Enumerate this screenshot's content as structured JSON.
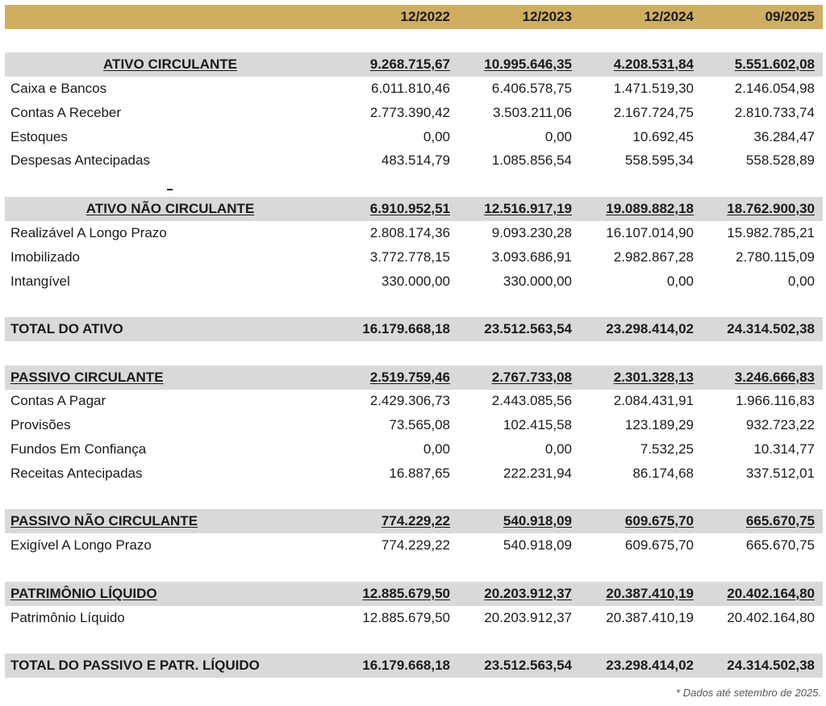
{
  "header": {
    "color": "#cfae62",
    "columns": [
      "12/2022",
      "12/2023",
      "12/2024",
      "09/2025"
    ]
  },
  "ativo_circulante": {
    "label": "ATIVO CIRCULANTE",
    "values": [
      "9.268.715,67",
      "10.995.646,35",
      "4.208.531,84",
      "5.551.602,08"
    ],
    "rows": [
      {
        "label": "Caixa e Bancos",
        "values": [
          "6.011.810,46",
          "6.406.578,75",
          "1.471.519,30",
          "2.146.054,98"
        ]
      },
      {
        "label": "Contas A Receber",
        "values": [
          "2.773.390,42",
          "3.503.211,06",
          "2.167.724,75",
          "2.810.733,74"
        ]
      },
      {
        "label": "Estoques",
        "values": [
          "0,00",
          "0,00",
          "10.692,45",
          "36.284,47"
        ]
      },
      {
        "label": "Despesas Antecipadas",
        "values": [
          "483.514,79",
          "1.085.856,54",
          "558.595,34",
          "558.528,89"
        ]
      }
    ]
  },
  "ativo_nao_circulante": {
    "label": "ATIVO NÃO CIRCULANTE",
    "values": [
      "6.910.952,51",
      "12.516.917,19",
      "19.089.882,18",
      "18.762.900,30"
    ],
    "rows": [
      {
        "label": "Realizável A Longo Prazo",
        "values": [
          "2.808.174,36",
          "9.093.230,28",
          "16.107.014,90",
          "15.982.785,21"
        ]
      },
      {
        "label": "Imobilizado",
        "values": [
          "3.772.778,15",
          "3.093.686,91",
          "2.982.867,28",
          "2.780.115,09"
        ]
      },
      {
        "label": "Intangível",
        "values": [
          "330.000,00",
          "330.000,00",
          "0,00",
          "0,00"
        ]
      }
    ]
  },
  "total_ativo": {
    "label": "TOTAL DO ATIVO",
    "values": [
      "16.179.668,18",
      "23.512.563,54",
      "23.298.414,02",
      "24.314.502,38"
    ]
  },
  "passivo_circulante": {
    "label": "PASSIVO CIRCULANTE",
    "values": [
      "2.519.759,46",
      "2.767.733,08",
      "2.301.328,13",
      "3.246.666,83"
    ],
    "rows": [
      {
        "label": "Contas A Pagar",
        "values": [
          "2.429.306,73",
          "2.443.085,56",
          "2.084.431,91",
          "1.966.116,83"
        ]
      },
      {
        "label": "Provisões",
        "values": [
          "73.565,08",
          "102.415,58",
          "123.189,29",
          "932.723,22"
        ]
      },
      {
        "label": "Fundos Em Confiança",
        "values": [
          "0,00",
          "0,00",
          "7.532,25",
          "10.314,77"
        ]
      },
      {
        "label": "Receitas Antecipadas",
        "values": [
          "16.887,65",
          "222.231,94",
          "86.174,68",
          "337.512,01"
        ]
      }
    ]
  },
  "passivo_nao_circulante": {
    "label": "PASSIVO NÃO CIRCULANTE",
    "values": [
      "774.229,22",
      "540.918,09",
      "609.675,70",
      "665.670,75"
    ],
    "rows": [
      {
        "label": "Exigível A Longo Prazo",
        "values": [
          "774.229,22",
          "540.918,09",
          "609.675,70",
          "665.670,75"
        ]
      }
    ]
  },
  "patrimonio_liquido": {
    "label": "PATRIMÔNIO LÍQUIDO",
    "values": [
      "12.885.679,50",
      "20.203.912,37",
      "20.387.410,19",
      "20.402.164,80"
    ],
    "rows": [
      {
        "label": "Patrimônio Líquido",
        "values": [
          "12.885.679,50",
          "20.203.912,37",
          "20.387.410,19",
          "20.402.164,80"
        ]
      }
    ]
  },
  "total_passivo": {
    "label": "TOTAL DO PASSIVO E PATR. LÍQUIDO",
    "values": [
      "16.179.668,18",
      "23.512.563,54",
      "23.298.414,02",
      "24.314.502,38"
    ]
  },
  "footnote": "* Dados até setembro de 2025."
}
